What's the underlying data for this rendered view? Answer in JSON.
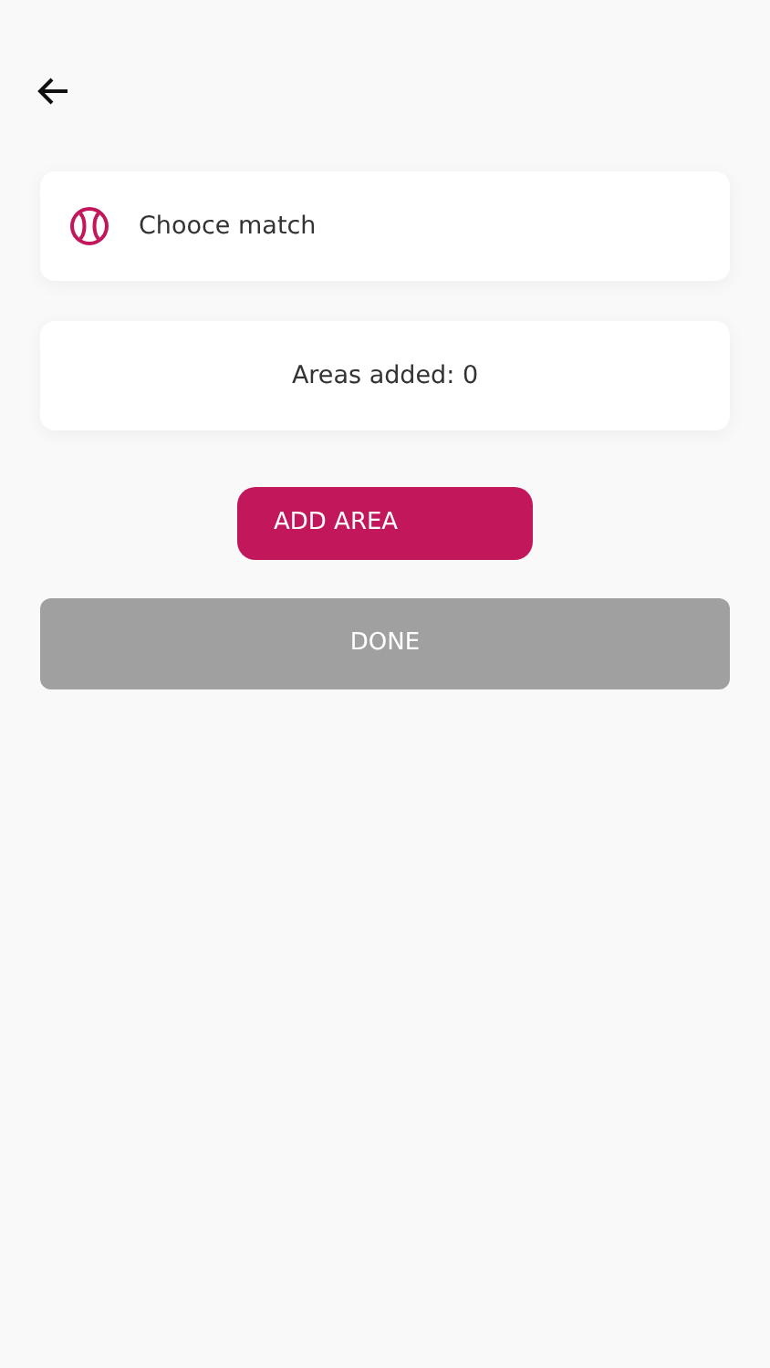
{
  "match_field": {
    "label": "Chooce match"
  },
  "areas_card": {
    "text": "Areas added: 0"
  },
  "add_button": {
    "label": "ADD AREA"
  },
  "done_button": {
    "label": "DONE",
    "disabled": true
  }
}
